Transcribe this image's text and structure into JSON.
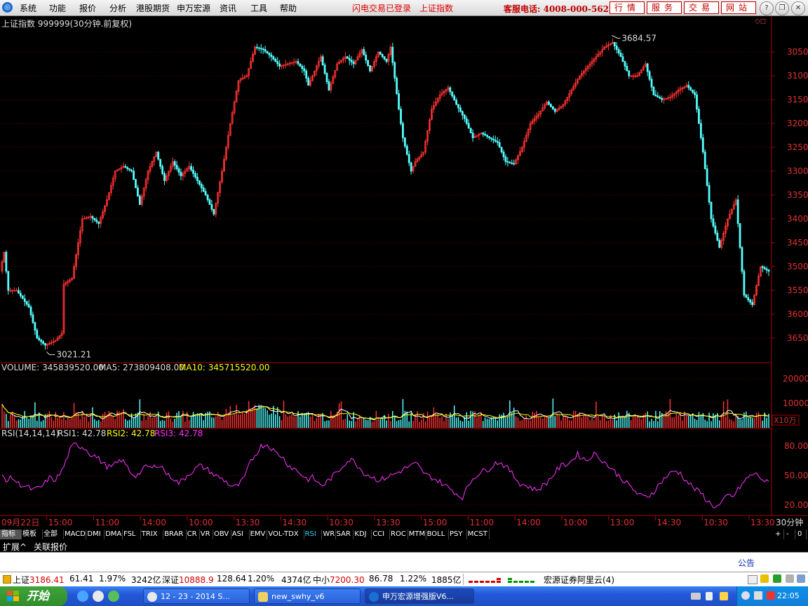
{
  "menu": {
    "logo_glyph": "◎",
    "items": [
      "系统",
      "功能",
      "报价",
      "分析",
      "港股期货",
      "申万宏源",
      "资讯",
      "工具",
      "帮助"
    ],
    "status_left": "闪电交易已登录",
    "status_right": "上证指数",
    "hotline": "客服电话: 4008-000-562",
    "buttons": [
      "行情",
      "服务",
      "交易",
      "网站"
    ],
    "window_buttons": {
      "help": "?",
      "restore": "❐",
      "close": "✕"
    }
  },
  "chart_title": "上证指数  999999(30分钟.前复权)",
  "corner_icons": "◇◻",
  "chart_data": [
    {
      "type": "candlestick",
      "title": "上证指数 999999(30分钟.前复权)",
      "y_ticks": [
        3050,
        3100,
        3150,
        3200,
        3250,
        3300,
        3350,
        3400,
        3450,
        3500,
        3550,
        3600,
        3650
      ],
      "ylim": [
        3000,
        3700
      ],
      "annotations": [
        {
          "label": "3684.57",
          "value": 3684.57,
          "kind": "max"
        },
        {
          "label": "3021.21",
          "value": 3021.21,
          "kind": "min"
        }
      ],
      "trend_points": [
        [
          0,
          3190
        ],
        [
          2,
          3230
        ],
        [
          4,
          3150
        ],
        [
          8,
          3150
        ],
        [
          14,
          3115
        ],
        [
          18,
          3050
        ],
        [
          22,
          3035
        ],
        [
          27,
          3045
        ],
        [
          30,
          3060
        ],
        [
          30,
          3160
        ],
        [
          35,
          3175
        ],
        [
          40,
          3300
        ],
        [
          44,
          3305
        ],
        [
          48,
          3290
        ],
        [
          52,
          3340
        ],
        [
          56,
          3400
        ],
        [
          60,
          3410
        ],
        [
          64,
          3400
        ],
        [
          68,
          3330
        ],
        [
          72,
          3400
        ],
        [
          76,
          3440
        ],
        [
          80,
          3380
        ],
        [
          84,
          3420
        ],
        [
          88,
          3390
        ],
        [
          92,
          3410
        ],
        [
          96,
          3380
        ],
        [
          100,
          3350
        ],
        [
          104,
          3310
        ],
        [
          108,
          3400
        ],
        [
          112,
          3500
        ],
        [
          116,
          3590
        ],
        [
          120,
          3600
        ],
        [
          124,
          3660
        ],
        [
          128,
          3655
        ],
        [
          132,
          3640
        ],
        [
          136,
          3620
        ],
        [
          140,
          3625
        ],
        [
          144,
          3630
        ],
        [
          148,
          3610
        ],
        [
          150,
          3580
        ],
        [
          152,
          3600
        ],
        [
          156,
          3640
        ],
        [
          160,
          3570
        ],
        [
          164,
          3625
        ],
        [
          168,
          3640
        ],
        [
          172,
          3625
        ],
        [
          176,
          3655
        ],
        [
          180,
          3610
        ],
        [
          184,
          3650
        ],
        [
          188,
          3630
        ],
        [
          190,
          3660
        ],
        [
          194,
          3530
        ],
        [
          196,
          3470
        ],
        [
          200,
          3400
        ],
        [
          202,
          3420
        ],
        [
          206,
          3440
        ],
        [
          210,
          3530
        ],
        [
          214,
          3560
        ],
        [
          218,
          3575
        ],
        [
          222,
          3540
        ],
        [
          226,
          3510
        ],
        [
          230,
          3470
        ],
        [
          234,
          3480
        ],
        [
          238,
          3470
        ],
        [
          242,
          3460
        ],
        [
          246,
          3420
        ],
        [
          250,
          3415
        ],
        [
          254,
          3450
        ],
        [
          258,
          3500
        ],
        [
          262,
          3520
        ],
        [
          266,
          3545
        ],
        [
          270,
          3525
        ],
        [
          274,
          3540
        ],
        [
          278,
          3570
        ],
        [
          282,
          3600
        ],
        [
          286,
          3620
        ],
        [
          290,
          3640
        ],
        [
          294,
          3660
        ],
        [
          298,
          3670
        ],
        [
          302,
          3640
        ],
        [
          306,
          3600
        ],
        [
          310,
          3600
        ],
        [
          314,
          3625
        ],
        [
          318,
          3560
        ],
        [
          322,
          3550
        ],
        [
          326,
          3555
        ],
        [
          330,
          3570
        ],
        [
          334,
          3580
        ],
        [
          338,
          3560
        ],
        [
          342,
          3440
        ],
        [
          346,
          3300
        ],
        [
          350,
          3240
        ],
        [
          354,
          3300
        ],
        [
          358,
          3340
        ],
        [
          362,
          3140
        ],
        [
          366,
          3120
        ],
        [
          370,
          3200
        ],
        [
          374,
          3190
        ]
      ],
      "y_axis_labels": [
        "3650",
        "3600",
        "3550",
        "3500",
        "3450",
        "3400",
        "3350",
        "3300",
        "3250",
        "3200",
        "3150",
        "3100",
        "3050"
      ]
    },
    {
      "type": "bar",
      "title": "VOLUME",
      "legend": {
        "volume": "VOLUME: 345839520.00",
        "ma5": "MA5: 273809408.00",
        "ma10": "MA10: 345715520.00"
      },
      "y_ticks": [
        10000,
        20000
      ],
      "unit_label": "X10万",
      "ylim": [
        0,
        24000
      ],
      "series_colors": {
        "ma5": "#ffffff",
        "ma10": "#ffff00"
      }
    },
    {
      "type": "line",
      "title": "RSI(14,14,14)",
      "legend": {
        "rsi1": "RSI1: 42.78",
        "rsi2": "RSI2: 42.78",
        "rsi3": "RSI3: 42.78"
      },
      "y_ticks": [
        20,
        50,
        80
      ],
      "y_tick_labels": [
        "20.00",
        "50.00",
        "80.00"
      ],
      "ylim": [
        10,
        90
      ],
      "values": [
        50,
        45,
        48,
        42,
        40,
        38,
        35,
        37,
        40,
        48,
        45,
        50,
        60,
        75,
        82,
        80,
        78,
        72,
        70,
        65,
        60,
        58,
        62,
        66,
        60,
        52,
        50,
        55,
        60,
        57,
        62,
        58,
        50,
        48,
        42,
        46,
        52,
        55,
        60,
        58,
        55,
        50,
        48,
        45,
        40,
        38,
        42,
        50,
        65,
        72,
        80,
        82,
        78,
        72,
        70,
        62,
        58,
        55,
        50,
        46,
        48,
        42,
        40,
        45,
        50,
        55,
        62,
        66,
        65,
        58,
        52,
        50,
        47,
        45,
        48,
        50,
        52,
        55,
        58,
        60,
        62,
        55,
        50,
        48,
        45,
        42,
        38,
        35,
        30,
        28,
        40,
        48,
        52,
        55,
        57,
        62,
        64,
        60,
        55,
        48,
        42,
        40,
        38,
        35,
        38,
        42,
        48,
        55,
        60,
        62,
        65,
        72,
        68,
        65,
        72,
        70,
        65,
        60,
        55,
        50,
        45,
        40,
        35,
        30,
        28,
        30,
        35,
        42,
        48,
        52,
        55,
        52,
        45,
        40,
        35,
        32,
        25,
        20,
        18,
        22,
        30,
        28,
        35,
        42,
        48,
        52,
        50,
        45,
        42
      ]
    }
  ],
  "x_axis": [
    "09月22日",
    "15:00",
    "11:00",
    "14:00",
    "10:00",
    "13:30",
    "14:30",
    "10:30",
    "13:30",
    "15:00",
    "11:00",
    "14:00",
    "10:00",
    "13:00",
    "14:30",
    "10:30",
    "13:30"
  ],
  "period_label": "30分钟",
  "indicator_tabs": [
    "指标",
    "模板",
    "全部",
    "MACD",
    "DMI",
    "DMA",
    "FSL",
    "TRIX",
    "BRAR",
    "CR",
    "VR",
    "OBV",
    "ASI",
    "EMV",
    "VOL-TDX",
    "RSI",
    "WR",
    "SAR",
    "KDJ",
    "CCI",
    "ROC",
    "MTM",
    "BOLL",
    "PSY",
    "MCST"
  ],
  "active_tab": "RSI",
  "tab_controls": [
    "+",
    "-",
    "0"
  ],
  "sub_tabs": [
    "扩展^",
    "关联报价"
  ],
  "notice_label": "公告",
  "status_bar": {
    "sh_label": "上证",
    "sh_value": "3186.41",
    "sh_change": "61.41",
    "sh_pct": "1.97%",
    "sh_amount": "3242亿",
    "sz_label": "深证",
    "sz_value": "10888.9",
    "sz_change": "128.64",
    "sz_pct": "1.20%",
    "sz_amount": "4374亿",
    "zx_label": "中小",
    "zx_value": "7200.30",
    "zx_change": "86.78",
    "zx_pct": "1.22%",
    "zx_amount": "1885亿",
    "broker": "宏源证券阿里云(4)"
  },
  "taskbar": {
    "start_label": "开始",
    "tasks": [
      "12 - 23 - 2014 S...",
      "new_swhy_v6",
      "申万宏源增强版V6..."
    ],
    "clock": "22:05"
  }
}
